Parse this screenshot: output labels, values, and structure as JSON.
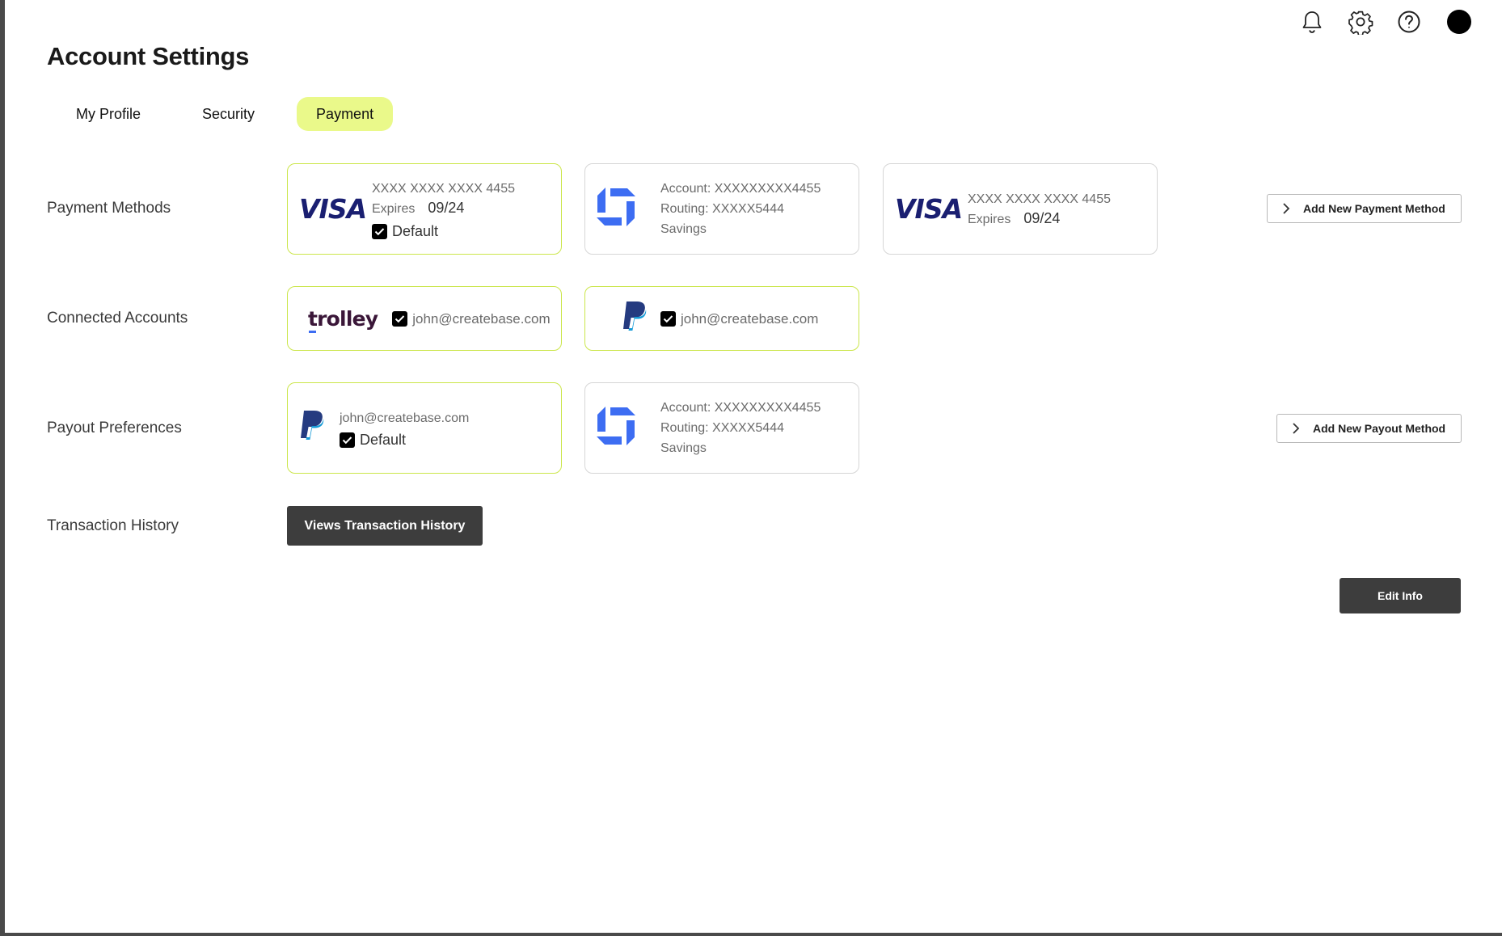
{
  "header": {
    "icons": [
      "bell-icon",
      "gear-icon",
      "help-icon",
      "avatar"
    ]
  },
  "page_title": "Account Settings",
  "tabs": [
    {
      "label": "My Profile",
      "active": false
    },
    {
      "label": "Security",
      "active": false
    },
    {
      "label": "Payment",
      "active": true
    }
  ],
  "colors": {
    "accent": "#eaf98a",
    "selected_border": "#cbe64a",
    "dark_button": "#3d3d3d",
    "visa_blue": "#1a1f71",
    "chase_blue": "#3d6df2",
    "paypal_dark": "#253b80",
    "paypal_light": "#179bd7"
  },
  "payment_methods": {
    "label": "Payment Methods",
    "cards": [
      {
        "brand": "VISA",
        "number": "XXXX XXXX XXXX 4455",
        "expires_label": "Expires",
        "expires": "09/24",
        "default_label": "Default",
        "selected": true
      },
      {
        "brand": "chase-logo",
        "account": "Account: XXXXXXXXX4455",
        "routing": "Routing: XXXXX5444",
        "type": "Savings",
        "selected": false
      },
      {
        "brand": "VISA",
        "number": "XXXX XXXX XXXX 4455",
        "expires_label": "Expires",
        "expires": "09/24",
        "selected": false
      }
    ],
    "add_button": "Add New Payment Method"
  },
  "connected_accounts": {
    "label": "Connected Accounts",
    "accounts": [
      {
        "brand": "trolley",
        "email": "john@createbase.com",
        "checked": true
      },
      {
        "brand": "paypal-logo",
        "email": "john@createbase.com",
        "checked": true
      }
    ]
  },
  "payout_preferences": {
    "label": "Payout Preferences",
    "cards": [
      {
        "brand": "paypal-logo",
        "email": "john@createbase.com",
        "default_label": "Default",
        "selected": true
      },
      {
        "brand": "chase-logo",
        "account": "Account: XXXXXXXXX4455",
        "routing": "Routing: XXXXX5444",
        "type": "Savings",
        "selected": false
      }
    ],
    "add_button": "Add New Payout Method"
  },
  "transaction_history": {
    "label": "Transaction History",
    "button": "Views Transaction History"
  },
  "edit_button": "Edit Info"
}
